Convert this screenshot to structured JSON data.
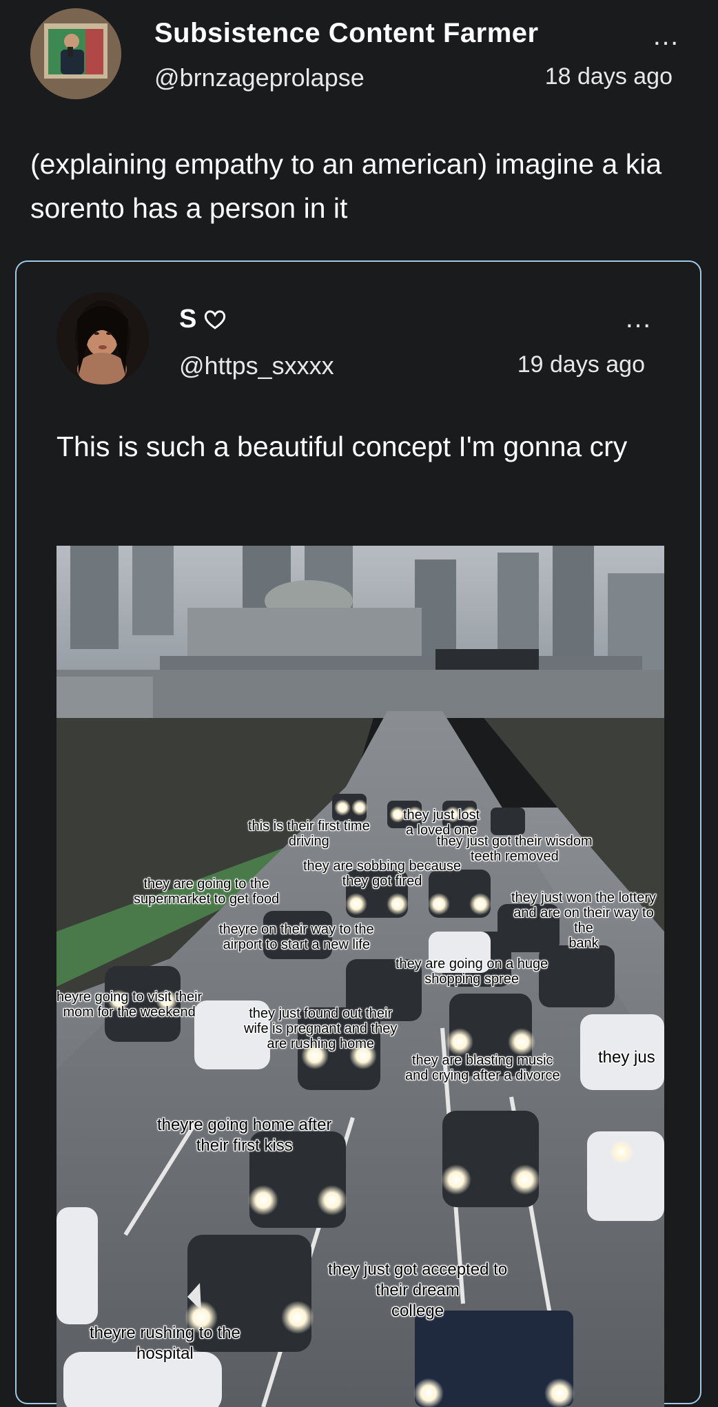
{
  "post": {
    "display_name": "Subsistence Content Farmer",
    "handle": "@brnzageprolapse",
    "time": "18 days ago",
    "more_icon": "…",
    "text": "(explaining empathy to an american) imagine a kia sorento has a person in it"
  },
  "quoted": {
    "display_name": "S",
    "handle": "@https_sxxxx",
    "time": "19 days ago",
    "more_icon": "…",
    "text": "This is such a beautiful concept I'm gonna cry",
    "image_captions": [
      "this is their first time\ndriving",
      "they just lost\na loved one",
      "they just got their wisdom\nteeth removed",
      "they are sobbing because\nthey got fired",
      "they are going to the\nsupermarket to get food",
      "they just won the lottery\nand are on their way to the\nbank",
      "theyre on their way to the\nairport to start a new life",
      "they are going on a huge\nshopping spree",
      "heyre going to visit their\nmom for the weekend",
      "they just found out their\nwife is pregnant and they\nare rushing home",
      "they are blasting music\nand crying after a divorce",
      "they jus",
      "theyre going home after\ntheir first kiss",
      "they just got accepted to\ntheir dream\ncollege",
      "theyre rushing to the\nhospital"
    ]
  },
  "colors": {
    "background": "#1a1b1d",
    "card_border": "#9fc9e6",
    "text": "#ffffff"
  }
}
